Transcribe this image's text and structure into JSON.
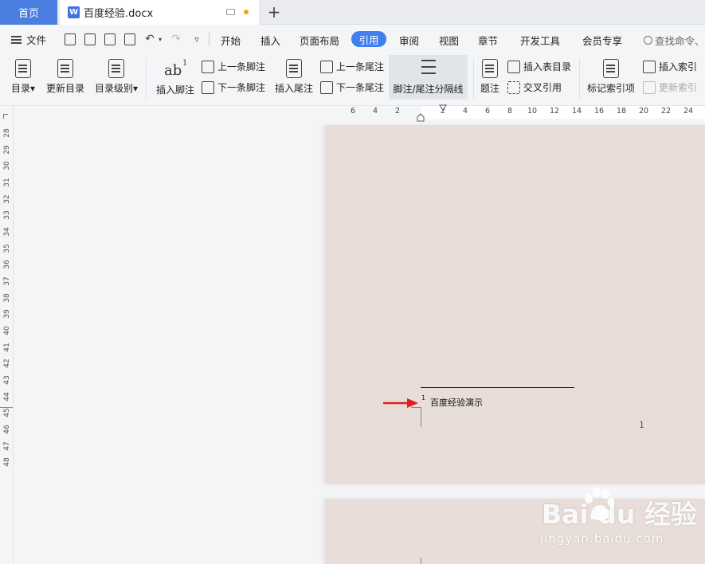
{
  "tabs": {
    "home_label": "首页",
    "doc_icon_letter": "W",
    "doc_label": "百度经验.docx",
    "add_label": "+"
  },
  "menu": {
    "file_label": "文件",
    "items": [
      "开始",
      "插入",
      "页面布局",
      "引用",
      "审阅",
      "视图",
      "章节",
      "开发工具",
      "会员专享"
    ],
    "active": "引用",
    "search_placeholder": "查找命令、"
  },
  "ribbon": {
    "toc_label": "目录",
    "update_toc_label": "更新目录",
    "toc_level_label": "目录级别",
    "insert_footnote_label": "插入脚注",
    "prev_footnote_label": "上一条脚注",
    "next_footnote_label": "下一条脚注",
    "insert_endnote_label": "插入尾注",
    "prev_endnote_label": "上一条尾注",
    "next_endnote_label": "下一条尾注",
    "separator_label": "脚注/尾注分隔线",
    "caption_label": "题注",
    "insert_table_of_figures_label": "插入表目录",
    "cross_reference_label": "交叉引用",
    "mark_index_label": "标记索引项",
    "insert_index_label": "插入索引",
    "update_index_label": "更新索引",
    "ab_glyph": "ab",
    "ab_superscript": "1"
  },
  "vertical_ruler": [
    "28",
    "29",
    "30",
    "31",
    "32",
    "33",
    "34",
    "35",
    "36",
    "37",
    "38",
    "39",
    "40",
    "41",
    "42",
    "43",
    "44",
    "45",
    "46",
    "47",
    "48"
  ],
  "horizontal_ruler": [
    "6",
    "4",
    "2",
    "2",
    "4",
    "6",
    "8",
    "10",
    "12",
    "14",
    "16",
    "18",
    "20",
    "22",
    "24"
  ],
  "document": {
    "footnote_number": "1",
    "footnote_text": "百度经验演示",
    "page_number": "1"
  },
  "watermark": {
    "logo": "Bai  du 经验",
    "url": "jingyan.baidu.com"
  },
  "colors": {
    "accent": "#3f7ff0",
    "home_tab": "#4a7ee0",
    "page": "#e8ddd8",
    "arrow": "#e02020"
  }
}
